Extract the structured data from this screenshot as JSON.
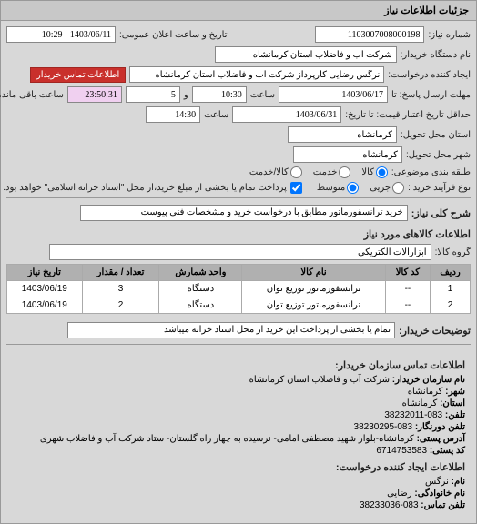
{
  "tab_title": "جزئیات اطلاعات نیاز",
  "header": {
    "need_number_label": "شماره نیاز:",
    "need_number": "1103007008000198",
    "announce_datetime_label": "تاریخ و ساعت اعلان عمومی:",
    "announce_datetime": "1403/06/11 - 10:29",
    "buyer_org_label": "نام دستگاه خریدار:",
    "buyer_org": "شرکت آب و فاضلاب استان کرمانشاه",
    "requester_label": "ایجاد کننده درخواست:",
    "requester": "نرگس رضایی کارپرداز شرکت آب و فاضلاب استان کرمانشاه",
    "contact_btn": "اطلاعات تماس خریدار",
    "deadline_label": "مهلت ارسال پاسخ: تا",
    "deadline_date": "1403/06/17",
    "time_label": "ساعت",
    "deadline_time": "10:30",
    "and_label": "و",
    "minute_value": "5",
    "remaining_time": "23:50:31",
    "remaining_label": "ساعت باقی مانده",
    "validity_label": "حداقل تاریخ اعتبار قیمت: تا تاریخ:",
    "validity_date": "1403/06/31",
    "validity_time": "14:30",
    "delivery_province_label": "استان محل تحویل:",
    "delivery_province": "کرمانشاه",
    "delivery_city_label": "شهر محل تحویل:",
    "delivery_city": "کرمانشاه",
    "category_label": "طبقه بندی موضوعی:",
    "category_goods": "کالا",
    "category_service": "خدمت",
    "category_goods_service": "کالا/خدمت",
    "process_label": "نوع فرآیند خرید :",
    "process_small": "جزیی",
    "process_medium": "متوسط",
    "process_note": "پرداخت تمام یا بخشی از مبلغ خرید،از محل \"اسناد خزانه اسلامی\" خواهد بود."
  },
  "need_summary": {
    "label": "شرح کلی نیاز:",
    "value": "خرید ترانسفورماتور مطابق با درخواست خرید و مشخصات فنی پیوست"
  },
  "goods_section": {
    "title": "اطلاعات کالاهای مورد نیاز",
    "group_label": "گروه کالا:",
    "group_value": "ابزارآلات الکتریکی"
  },
  "table": {
    "headers": [
      "ردیف",
      "کد کالا",
      "نام کالا",
      "واحد شمارش",
      "تعداد / مقدار",
      "تاریخ نیاز"
    ],
    "rows": [
      [
        "1",
        "--",
        "ترانسفورماتور توزیع توان",
        "دستگاه",
        "3",
        "1403/06/19"
      ],
      [
        "2",
        "--",
        "ترانسفورماتور توزیع توان",
        "دستگاه",
        "2",
        "1403/06/19"
      ]
    ]
  },
  "buyer_notes": {
    "label": "توضیحات خریدار:",
    "value": "تمام یا بخشی از پرداخت این خرید از محل اسناد خزانه میباشد"
  },
  "contact_section": {
    "title": "اطلاعات تماس سازمان خریدار:",
    "org_label": "نام سازمان خریدار:",
    "org": "شرکت آب و فاضلاب استان کرمانشاه",
    "city_label": "شهر:",
    "city": "کرمانشاه",
    "province_label": "استان:",
    "province": "کرمانشاه",
    "phone_label": "تلفن:",
    "phone": "083-38232011",
    "fax_label": "تلفن دورنگار:",
    "fax": "083-38230295",
    "address_label": "آدرس پستی:",
    "address": "کرمانشاه-بلوار شهید مصطفی امامی- نرسیده به چهار راه گلستان- ستاد شرکت آب و فاضلاب شهری",
    "postal_label": "کد پستی:",
    "postal": "6714753583"
  },
  "requester_section": {
    "title": "اطلاعات ایجاد کننده درخواست:",
    "name_label": "نام:",
    "name": "نرگس",
    "lastname_label": "نام خانوادگی:",
    "lastname": "رضایی",
    "phone_label": "تلفن تماس:",
    "phone": "083-38233036"
  }
}
